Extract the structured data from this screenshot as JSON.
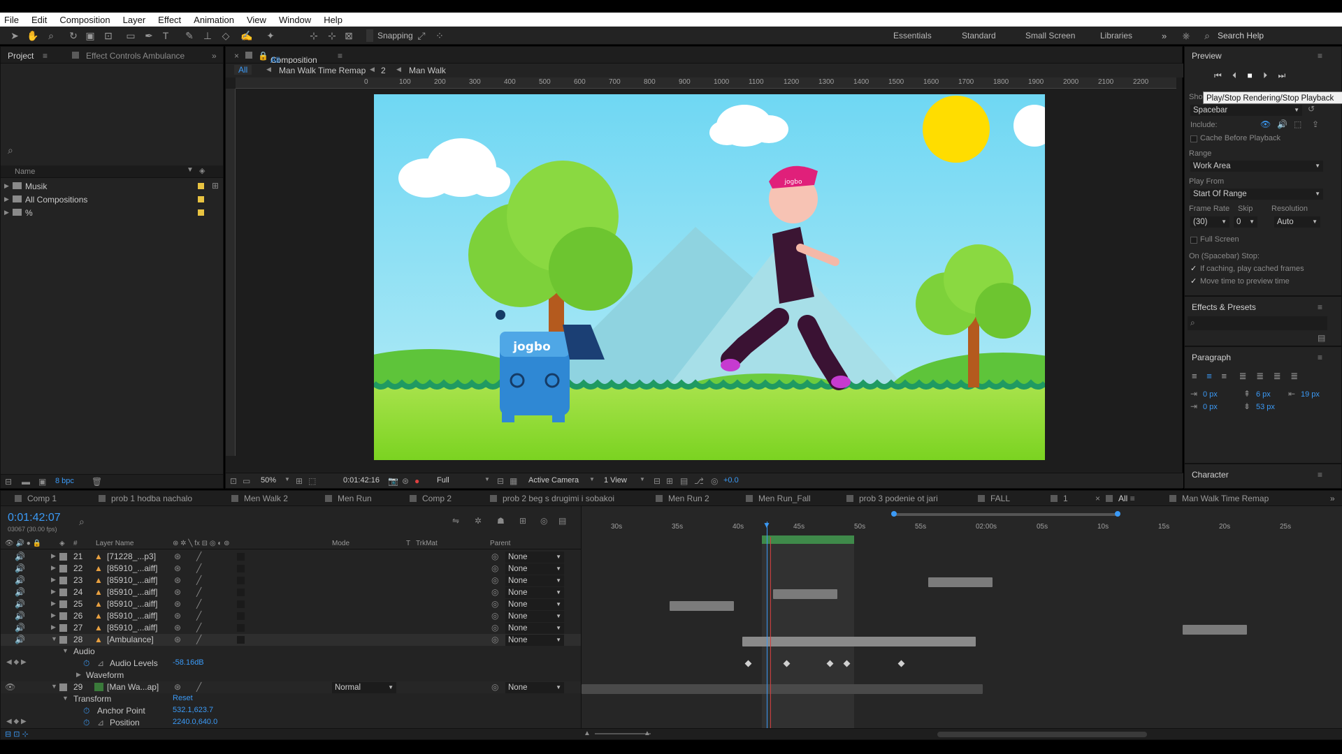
{
  "menu": [
    "File",
    "Edit",
    "Composition",
    "Layer",
    "Effect",
    "Animation",
    "View",
    "Window",
    "Help"
  ],
  "toolbar": {
    "snapping": "Snapping",
    "workspaces": [
      "Essentials",
      "Standard",
      "Small Screen",
      "Libraries"
    ],
    "search_help": "Search Help"
  },
  "project_panel": {
    "tab_project": "Project",
    "tab_effect_controls": "Effect Controls Ambulance",
    "col_name": "Name",
    "items": [
      "Musik",
      "All Compositions",
      "%"
    ],
    "bpc": "8 bpc"
  },
  "comp_panel": {
    "tab_title": "Composition",
    "tab_title_suffix": "All",
    "breadcrumbs": [
      "All",
      "Man Walk Time Remap",
      "2",
      "Man Walk"
    ],
    "ruler_ticks": [
      "0",
      "100",
      "200",
      "300",
      "400",
      "500",
      "600",
      "700",
      "800",
      "900",
      "1000",
      "1100",
      "1200",
      "1300",
      "1400",
      "1500",
      "1600",
      "1700",
      "1800",
      "1900",
      "2000",
      "2100",
      "2200"
    ],
    "zoom": "50%",
    "timecode": "0:01:42:16",
    "quality": "Full",
    "camera": "Active Camera",
    "views": "1 View",
    "exposure": "+0.0",
    "logo_text": "jogbo",
    "cap_text": "jogbo"
  },
  "preview": {
    "title": "Preview",
    "tooltip": "Play/Stop Rendering/Stop Playback",
    "shortcut_label": "Sho",
    "shortcut": "Spacebar",
    "include": "Include:",
    "cache_before": "Cache Before Playback",
    "range_label": "Range",
    "range": "Work Area",
    "play_from_label": "Play From",
    "play_from": "Start Of Range",
    "frame_rate_label": "Frame Rate",
    "skip_label": "Skip",
    "resolution_label": "Resolution",
    "frame_rate": "(30)",
    "skip": "0",
    "resolution": "Auto",
    "full_screen": "Full Screen",
    "on_stop": "On (Spacebar) Stop:",
    "if_caching": "If caching, play cached frames",
    "move_time": "Move time to preview time"
  },
  "effects_presets": {
    "title": "Effects & Presets"
  },
  "paragraph": {
    "title": "Paragraph",
    "indent_left": "0 px",
    "space_before": "6 px",
    "indent_right": "19 px",
    "indent_first": "0 px",
    "space_after": "53 px"
  },
  "character": {
    "title": "Character"
  },
  "timeline": {
    "tabs": [
      "Comp 1",
      "prob 1 hodba nachalo",
      "Men Walk 2",
      "Men Run",
      "Comp 2",
      "prob 2 beg s drugimi i sobakoi",
      "Men Run 2",
      "Men Run_Fall",
      "prob 3 podenie ot jari",
      "FALL",
      "1",
      "All",
      "Man Walk Time Remap"
    ],
    "timecode": "0:01:42:07",
    "frames": "03067 (30.00 fps)",
    "col_layer_name": "Layer Name",
    "col_mode": "Mode",
    "col_t": "T",
    "col_trkmat": "TrkMat",
    "col_parent": "Parent",
    "ruler": [
      "30s",
      "35s",
      "40s",
      "45s",
      "50s",
      "55s",
      "02:00s",
      "05s",
      "10s",
      "15s",
      "20s",
      "25s"
    ],
    "layers": [
      {
        "num": "21",
        "name": "[71228_...p3]",
        "parent": "None"
      },
      {
        "num": "22",
        "name": "[85910_...aiff]",
        "parent": "None"
      },
      {
        "num": "23",
        "name": "[85910_...aiff]",
        "parent": "None"
      },
      {
        "num": "24",
        "name": "[85910_...aiff]",
        "parent": "None"
      },
      {
        "num": "25",
        "name": "[85910_...aiff]",
        "parent": "None"
      },
      {
        "num": "26",
        "name": "[85910_...aiff]",
        "parent": "None"
      },
      {
        "num": "27",
        "name": "[85910_...aiff]",
        "parent": "None"
      },
      {
        "num": "28",
        "name": "[Ambulance]",
        "parent": "None"
      }
    ],
    "audio": "Audio",
    "audio_levels": "Audio Levels",
    "audio_levels_value": "-58.16dB",
    "waveform": "Waveform",
    "layer29": {
      "num": "29",
      "name": "[Man Wa...ap]",
      "mode": "Normal",
      "parent": "None"
    },
    "transform": "Transform",
    "reset": "Reset",
    "anchor_point": "Anchor Point",
    "anchor_point_value": "532.1,623.7",
    "position": "Position",
    "position_value": "2240.0,640.0"
  }
}
